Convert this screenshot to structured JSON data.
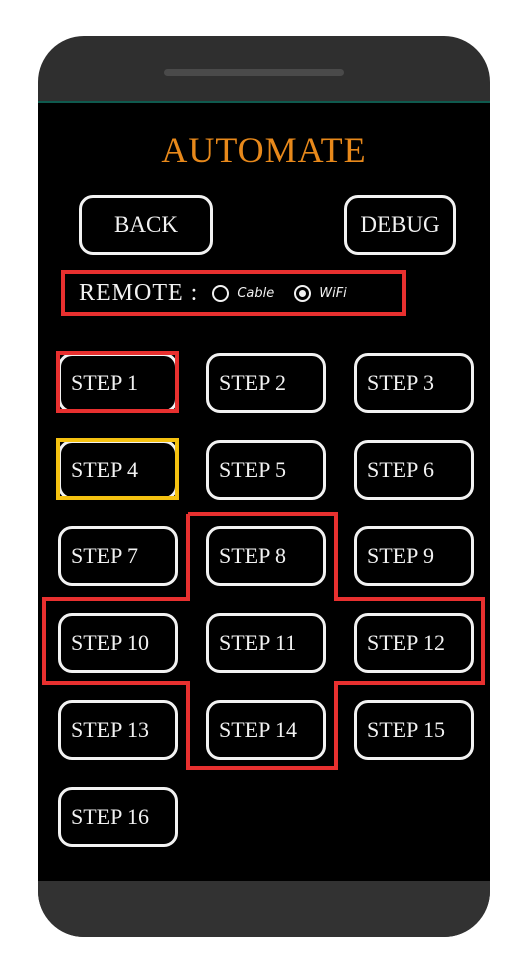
{
  "app": {
    "title": "AUTOMATE",
    "title_color": "#e8891b"
  },
  "header": {
    "back_label": "BACK",
    "debug_label": "DEBUG"
  },
  "remote": {
    "label": "REMOTE :",
    "options": [
      {
        "label": "Cable",
        "selected": false
      },
      {
        "label": "WiFi",
        "selected": true
      }
    ]
  },
  "steps": [
    {
      "label": "STEP 1",
      "highlight": "red"
    },
    {
      "label": "STEP 2"
    },
    {
      "label": "STEP 3"
    },
    {
      "label": "STEP 4",
      "highlight": "yellow"
    },
    {
      "label": "STEP 5"
    },
    {
      "label": "STEP 6"
    },
    {
      "label": "STEP 7"
    },
    {
      "label": "STEP 8"
    },
    {
      "label": "STEP 9"
    },
    {
      "label": "STEP 10"
    },
    {
      "label": "STEP 11"
    },
    {
      "label": "STEP 12"
    },
    {
      "label": "STEP 13"
    },
    {
      "label": "STEP 14"
    },
    {
      "label": "STEP 15"
    },
    {
      "label": "STEP 16"
    }
  ],
  "annotations": {
    "red_color": "#e8302f",
    "yellow_color": "#f5c211"
  }
}
